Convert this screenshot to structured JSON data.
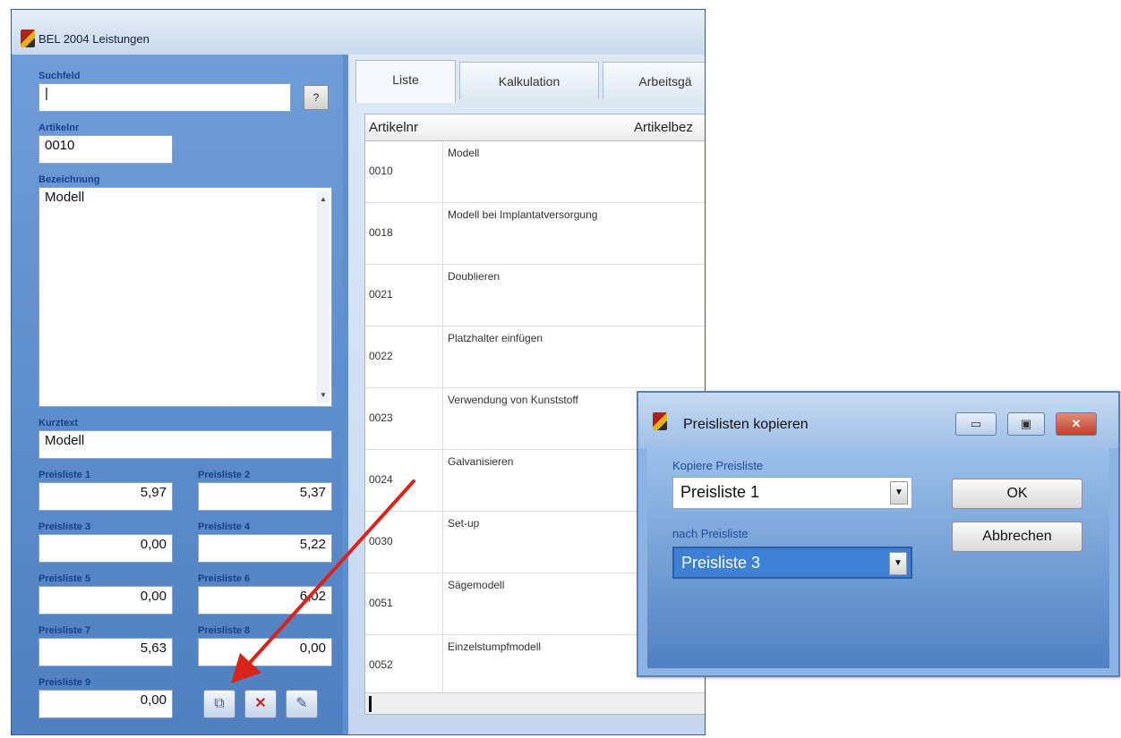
{
  "main_window": {
    "title": "BEL 2004 Leistungen"
  },
  "left": {
    "suchfeld_label": "Suchfeld",
    "suchfeld_value": "|",
    "help_button": "?",
    "artikelnr_label": "Artikelnr",
    "artikelnr_value": "0010",
    "bezeichnung_label": "Bezeichnung",
    "bezeichnung_value": "Modell",
    "kurztext_label": "Kurztext",
    "kurztext_value": "Modell",
    "preislisten": [
      {
        "label": "Preisliste 1",
        "value": "5,97"
      },
      {
        "label": "Preisliste 2",
        "value": "5,37"
      },
      {
        "label": "Preisliste 3",
        "value": "0,00"
      },
      {
        "label": "Preisliste 4",
        "value": "5,22"
      },
      {
        "label": "Preisliste 5",
        "value": "0,00"
      },
      {
        "label": "Preisliste 6",
        "value": "6,02"
      },
      {
        "label": "Preisliste 7",
        "value": "5,63"
      },
      {
        "label": "Preisliste 8",
        "value": "0,00"
      },
      {
        "label": "Preisliste 9",
        "value": "0,00"
      }
    ],
    "tools": [
      "copy-icon",
      "delete-icon",
      "edit-icon"
    ]
  },
  "tabs": [
    {
      "label": "Liste"
    },
    {
      "label": "Kalkulation"
    },
    {
      "label": "Arbeitsgä"
    }
  ],
  "grid": {
    "columns": [
      "Artikelnr",
      "Artikelbez"
    ],
    "rows": [
      {
        "nr": "0010",
        "desc": "Modell"
      },
      {
        "nr": "0018",
        "desc": "Modell bei Implantatversorgung"
      },
      {
        "nr": "0021",
        "desc": "Doublieren"
      },
      {
        "nr": "0022",
        "desc": "Platzhalter einfügen"
      },
      {
        "nr": "0023",
        "desc": "Verwendung von Kunststoff"
      },
      {
        "nr": "0024",
        "desc": "Galvanisieren"
      },
      {
        "nr": "0030",
        "desc": "Set-up"
      },
      {
        "nr": "0051",
        "desc": "Sägemodell"
      },
      {
        "nr": "0052",
        "desc": "Einzelstumpfmodell"
      }
    ]
  },
  "dialog": {
    "title": "Preislisten kopieren",
    "from_label": "Kopiere Preisliste",
    "from_value": "Preisliste 1",
    "to_label": "nach Preisliste",
    "to_value": "Preisliste 3",
    "ok_label": "OK",
    "cancel_label": "Abbrechen"
  },
  "colors": {
    "annotation_arrow": "#d9241c",
    "selection": "#3d80d4"
  }
}
